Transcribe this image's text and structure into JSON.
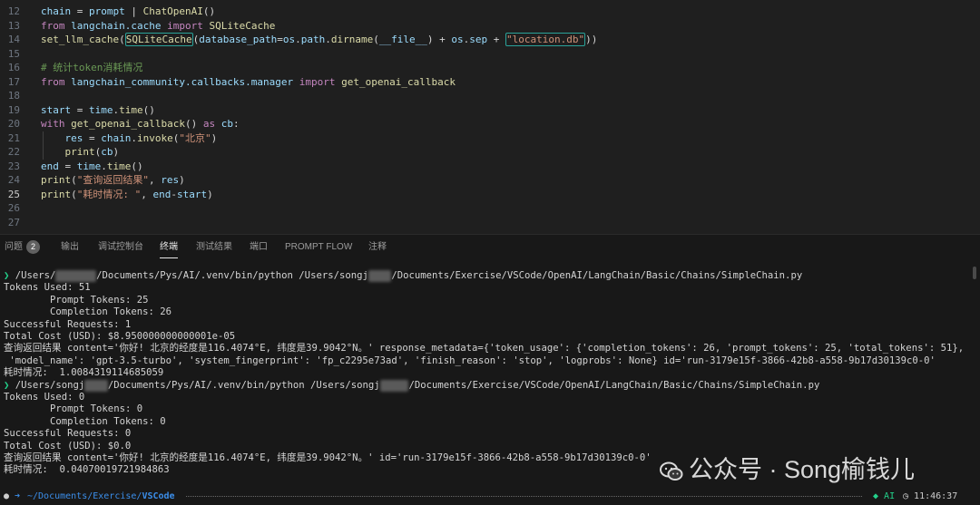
{
  "editor": {
    "lines": [
      {
        "num": "12",
        "segs": [
          [
            "v",
            "chain"
          ],
          [
            "p",
            " = "
          ],
          [
            "v",
            "prompt"
          ],
          [
            "p",
            " | "
          ],
          [
            "f",
            "ChatOpenAI"
          ],
          [
            "p",
            "()"
          ]
        ]
      },
      {
        "num": "13",
        "segs": [
          [
            "k",
            "from"
          ],
          [
            "p",
            " "
          ],
          [
            "v",
            "langchain.cache"
          ],
          [
            "p",
            " "
          ],
          [
            "k",
            "import"
          ],
          [
            "p",
            " "
          ],
          [
            "f",
            "SQLiteCache"
          ]
        ]
      },
      {
        "num": "14",
        "segs": [
          [
            "f",
            "set_llm_cache"
          ],
          [
            "p",
            "("
          ],
          [
            "box",
            "SQLiteCache"
          ],
          [
            "p",
            "("
          ],
          [
            "v",
            "database_path"
          ],
          [
            "p",
            "="
          ],
          [
            "v",
            "os"
          ],
          [
            "p",
            "."
          ],
          [
            "v",
            "path"
          ],
          [
            "p",
            "."
          ],
          [
            "f",
            "dirname"
          ],
          [
            "p",
            "("
          ],
          [
            "v",
            "__file__"
          ],
          [
            "p",
            ") + "
          ],
          [
            "v",
            "os"
          ],
          [
            "p",
            "."
          ],
          [
            "v",
            "sep"
          ],
          [
            "p",
            " + "
          ],
          [
            "sbox",
            "\"location.db\""
          ],
          [
            "p",
            "))"
          ]
        ]
      },
      {
        "num": "15",
        "segs": []
      },
      {
        "num": "16",
        "segs": [
          [
            "c",
            "# 统计token消耗情况"
          ]
        ]
      },
      {
        "num": "17",
        "segs": [
          [
            "k",
            "from"
          ],
          [
            "p",
            " "
          ],
          [
            "v",
            "langchain_community.callbacks.manager"
          ],
          [
            "p",
            " "
          ],
          [
            "k",
            "import"
          ],
          [
            "p",
            " "
          ],
          [
            "f",
            "get_openai_callback"
          ]
        ]
      },
      {
        "num": "18",
        "segs": []
      },
      {
        "num": "19",
        "segs": [
          [
            "v",
            "start"
          ],
          [
            "p",
            " = "
          ],
          [
            "v",
            "time"
          ],
          [
            "p",
            "."
          ],
          [
            "f",
            "time"
          ],
          [
            "p",
            "()"
          ]
        ]
      },
      {
        "num": "20",
        "segs": [
          [
            "k",
            "with"
          ],
          [
            "p",
            " "
          ],
          [
            "f",
            "get_openai_callback"
          ],
          [
            "p",
            "() "
          ],
          [
            "k",
            "as"
          ],
          [
            "p",
            " "
          ],
          [
            "v",
            "cb"
          ],
          [
            "p",
            ":"
          ]
        ]
      },
      {
        "num": "21",
        "segs": [
          [
            "p",
            "    "
          ],
          [
            "v",
            "res"
          ],
          [
            "p",
            " = "
          ],
          [
            "v",
            "chain"
          ],
          [
            "p",
            "."
          ],
          [
            "f",
            "invoke"
          ],
          [
            "p",
            "("
          ],
          [
            "s",
            "\"北京\""
          ],
          [
            "p",
            ")"
          ]
        ]
      },
      {
        "num": "22",
        "segs": [
          [
            "p",
            "    "
          ],
          [
            "f",
            "print"
          ],
          [
            "p",
            "("
          ],
          [
            "v",
            "cb"
          ],
          [
            "p",
            ")"
          ]
        ]
      },
      {
        "num": "23",
        "segs": [
          [
            "v",
            "end"
          ],
          [
            "p",
            " = "
          ],
          [
            "v",
            "time"
          ],
          [
            "p",
            "."
          ],
          [
            "f",
            "time"
          ],
          [
            "p",
            "()"
          ]
        ]
      },
      {
        "num": "24",
        "segs": [
          [
            "f",
            "print"
          ],
          [
            "p",
            "("
          ],
          [
            "s",
            "\"查询返回结果\""
          ],
          [
            "p",
            ", "
          ],
          [
            "v",
            "res"
          ],
          [
            "p",
            ")"
          ]
        ]
      },
      {
        "num": "25",
        "segs": [
          [
            "f",
            "print"
          ],
          [
            "p",
            "("
          ],
          [
            "s",
            "\"耗时情况: \""
          ],
          [
            "p",
            ", "
          ],
          [
            "v",
            "end"
          ],
          [
            "p",
            "-"
          ],
          [
            "v",
            "start"
          ],
          [
            "p",
            ")"
          ]
        ]
      },
      {
        "num": "26",
        "segs": []
      },
      {
        "num": "27",
        "segs": []
      }
    ],
    "current_line": "25"
  },
  "panel": {
    "tabs": [
      {
        "label": "问题",
        "badge": "2"
      },
      {
        "label": "输出"
      },
      {
        "label": "调试控制台"
      },
      {
        "label": "终端",
        "active": true
      },
      {
        "label": "测试结果"
      },
      {
        "label": "端口"
      },
      {
        "label": "PROMPT FLOW"
      },
      {
        "label": "注释"
      }
    ]
  },
  "terminal": {
    "lines": [
      {
        "arrow": true,
        "pre": " /Users/",
        "blur": "xxxxxxx",
        "post": "/Documents/Pys/AI/.venv/bin/python /Users/songj",
        "blur2": "xxxx",
        "post2": "/Documents/Exercise/VSCode/OpenAI/LangChain/Basic/Chains/SimpleChain.py"
      },
      {
        "text": "Tokens Used: 51"
      },
      {
        "text": "\tPrompt Tokens: 25"
      },
      {
        "text": "\tCompletion Tokens: 26"
      },
      {
        "text": "Successful Requests: 1"
      },
      {
        "text": "Total Cost (USD): $8.950000000000001e-05"
      },
      {
        "text": "查询返回结果 content='你好! 北京的经度是116.4074°E, 纬度是39.9042°N。' response_metadata={'token_usage': {'completion_tokens': 26, 'prompt_tokens': 25, 'total_tokens': 51},"
      },
      {
        "text": " 'model_name': 'gpt-3.5-turbo', 'system_fingerprint': 'fp_c2295e73ad', 'finish_reason': 'stop', 'logprobs': None} id='run-3179e15f-3866-42b8-a558-9b17d30139c0-0'"
      },
      {
        "text": "耗时情况:  1.0084319114685059"
      },
      {
        "arrow": true,
        "pre": " /Users/songj",
        "blur": "xxxx",
        "post": "/Documents/Pys/AI/.venv/bin/python /Users/songj",
        "blur2": "xxxxx",
        "post2": "/Documents/Exercise/VSCode/OpenAI/LangChain/Basic/Chains/SimpleChain.py"
      },
      {
        "text": "Tokens Used: 0"
      },
      {
        "text": "\tPrompt Tokens: 0"
      },
      {
        "text": "\tCompletion Tokens: 0"
      },
      {
        "text": "Successful Requests: 0"
      },
      {
        "text": "Total Cost (USD): $0.0"
      },
      {
        "text": "查询返回结果 content='你好! 北京的经度是116.4074°E, 纬度是39.9042°N。' id='run-3179e15f-3866-42b8-a558-9b17d30139c0-0'"
      },
      {
        "text": "耗时情况:  0.04070019721984863"
      }
    ]
  },
  "status": {
    "path_prefix": "~/Documents/Exercise/",
    "path_current": "VSCode",
    "ai_label": "AI",
    "time": "11:46:37"
  },
  "watermark": {
    "text": "公众号 · Song榆钱儿"
  },
  "colors": {
    "accent_box": "#2aa39a",
    "prompt_green": "#23d18b",
    "status_path": "#3b8eea"
  }
}
